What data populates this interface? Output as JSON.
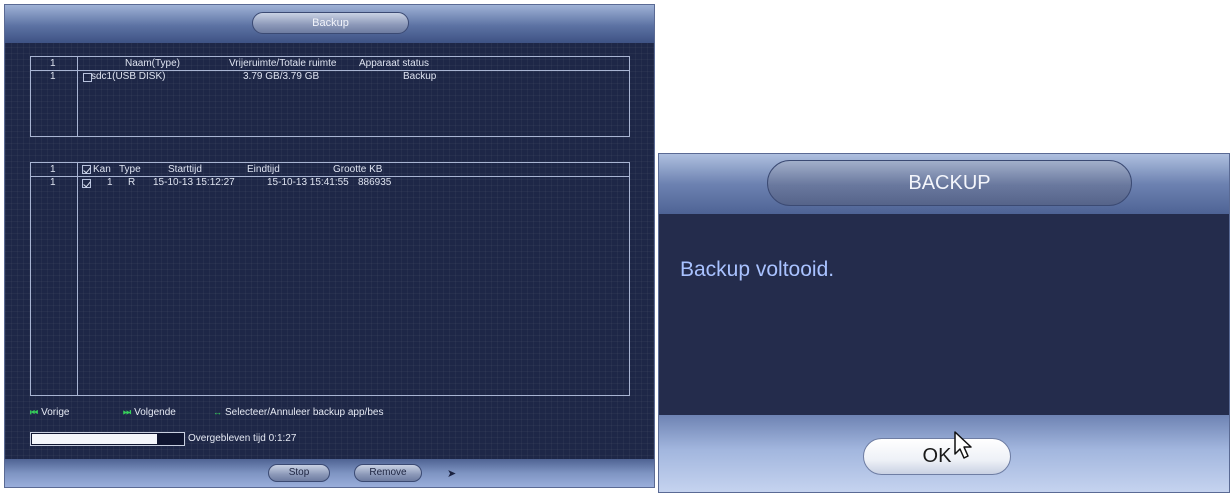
{
  "backup_window": {
    "title": "Backup",
    "devices_table": {
      "count": "1",
      "headers": {
        "name": "Naam(Type)",
        "space": "Vrijeruimte/Totale ruimte",
        "status": "Apparaat status"
      },
      "rows": [
        {
          "index": "1",
          "checked": false,
          "name": "sdc1(USB DISK)",
          "space": "3.79 GB/3.79 GB",
          "status": "Backup"
        }
      ]
    },
    "files_table": {
      "count": "1",
      "headers": {
        "channel": "Kan",
        "type": "Type",
        "start": "Starttijd",
        "end": "Eindtijd",
        "size": "Grootte KB"
      },
      "header_checked": true,
      "rows": [
        {
          "index": "1",
          "checked": true,
          "channel": "1",
          "type": "R",
          "start": "15-10-13 15:12:27",
          "end": "15-10-13 15:41:55",
          "size": "886935"
        }
      ]
    },
    "nav": {
      "prev": "Vorige",
      "next": "Volgende",
      "select": "Selecteer/Annuleer backup app/bes"
    },
    "progress": {
      "fraction": 0.83,
      "label": "Overgebleven tijd 0:1:27"
    },
    "buttons": {
      "stop": "Stop",
      "remove": "Remove"
    }
  },
  "result_dialog": {
    "title": "BACKUP",
    "message": "Backup voltooid.",
    "ok_label": "OK"
  },
  "colors": {
    "panel_bg": "#1e2747",
    "message_text": "#a9c2ff",
    "nav_icon": "#36d05a"
  }
}
